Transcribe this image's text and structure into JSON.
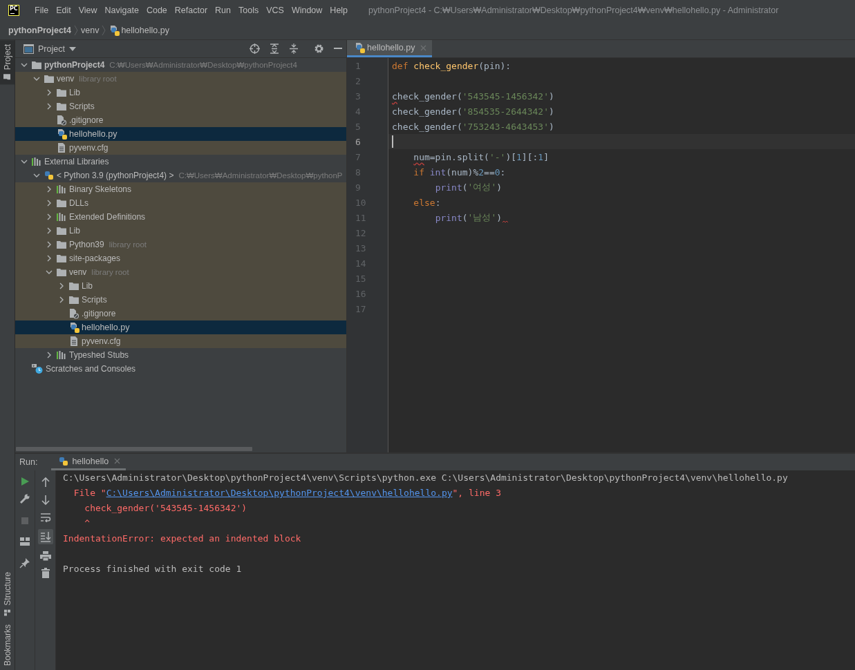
{
  "menubar": {
    "logo": "PC",
    "items": [
      "File",
      "Edit",
      "View",
      "Navigate",
      "Code",
      "Refactor",
      "Run",
      "Tools",
      "VCS",
      "Window",
      "Help"
    ],
    "title": "pythonProject4 - C:₩Users₩Administrator₩Desktop₩pythonProject4₩venv₩hellohello.py - Administrator"
  },
  "breadcrumbs": [
    {
      "label": "pythonProject4",
      "kind": "project"
    },
    {
      "label": "venv",
      "kind": "folder"
    },
    {
      "label": "hellohello.py",
      "kind": "python-file"
    }
  ],
  "tool_strip": {
    "top": [
      {
        "label": "Project",
        "kind": "project",
        "selected": true
      }
    ],
    "bottom": [
      {
        "label": "Structure",
        "kind": "structure",
        "selected": false
      },
      {
        "label": "Bookmarks",
        "kind": "bookmarks",
        "selected": false
      }
    ]
  },
  "project_panel": {
    "title": "Project",
    "tree": [
      {
        "label": "pythonProject4",
        "hint": "C:₩Users₩Administrator₩Desktop₩pythonProject4",
        "kind": "root",
        "expanded": true,
        "tinted": false,
        "selected": false,
        "children": [
          {
            "label": "venv",
            "hint": "library root",
            "kind": "folder",
            "expanded": true,
            "tinted": true,
            "selected": false,
            "children": [
              {
                "label": "Lib",
                "kind": "folder",
                "expanded": false,
                "tinted": true,
                "selected": false
              },
              {
                "label": "Scripts",
                "kind": "folder",
                "expanded": false,
                "tinted": true,
                "selected": false
              },
              {
                "label": ".gitignore",
                "kind": "ignored-file",
                "tinted": true,
                "selected": false
              },
              {
                "label": "hellohello.py",
                "kind": "python-file",
                "tinted": true,
                "selected": true
              },
              {
                "label": "pyvenv.cfg",
                "kind": "text-file",
                "tinted": true,
                "selected": false
              }
            ]
          }
        ]
      },
      {
        "label": "External Libraries",
        "kind": "library",
        "expanded": true,
        "tinted": false,
        "selected": false,
        "children": [
          {
            "label": "< Python 3.9 (pythonProject4) >",
            "hint": "C:₩Users₩Administrator₩Desktop₩pythonP",
            "kind": "python-sdk",
            "expanded": true,
            "tinted": false,
            "selected": false,
            "children": [
              {
                "label": "Binary Skeletons",
                "kind": "library",
                "expanded": false,
                "tinted": true,
                "selected": false
              },
              {
                "label": "DLLs",
                "kind": "folder",
                "expanded": false,
                "tinted": true,
                "selected": false
              },
              {
                "label": "Extended Definitions",
                "kind": "library",
                "expanded": false,
                "tinted": true,
                "selected": false
              },
              {
                "label": "Lib",
                "kind": "folder",
                "expanded": false,
                "tinted": true,
                "selected": false
              },
              {
                "label": "Python39",
                "hint": "library root",
                "kind": "folder",
                "expanded": false,
                "tinted": true,
                "selected": false
              },
              {
                "label": "site-packages",
                "kind": "folder",
                "expanded": false,
                "tinted": true,
                "selected": false
              },
              {
                "label": "venv",
                "hint": "library root",
                "kind": "folder",
                "expanded": true,
                "tinted": true,
                "selected": false,
                "children": [
                  {
                    "label": "Lib",
                    "kind": "folder",
                    "expanded": false,
                    "tinted": true,
                    "selected": false
                  },
                  {
                    "label": "Scripts",
                    "kind": "folder",
                    "expanded": false,
                    "tinted": true,
                    "selected": false
                  },
                  {
                    "label": ".gitignore",
                    "kind": "ignored-file",
                    "tinted": true,
                    "selected": false
                  },
                  {
                    "label": "hellohello.py",
                    "kind": "python-file",
                    "tinted": true,
                    "selected": true
                  },
                  {
                    "label": "pyvenv.cfg",
                    "kind": "text-file",
                    "tinted": true,
                    "selected": false
                  }
                ]
              },
              {
                "label": "Typeshed Stubs",
                "kind": "library",
                "expanded": false,
                "tinted": false,
                "selected": false
              }
            ]
          }
        ]
      },
      {
        "label": "Scratches and Consoles",
        "kind": "scratches",
        "tinted": false,
        "selected": false
      }
    ]
  },
  "editor": {
    "tabs": [
      {
        "label": "hellohello.py",
        "selected": true
      }
    ],
    "lines": [
      {
        "number": "1",
        "tokens": [
          {
            "text": "def ",
            "kind": "keyword"
          },
          {
            "text": "check_gender",
            "kind": "function"
          },
          {
            "text": "(pin):",
            "kind": "plain"
          }
        ]
      },
      {
        "number": "2"
      },
      {
        "number": "3",
        "tokens": [
          {
            "text": "c",
            "kind": "plain",
            "squiggle": true
          },
          {
            "text": "heck_gender(",
            "kind": "plain"
          },
          {
            "text": "'543545-1456342'",
            "kind": "string"
          },
          {
            "text": ")",
            "kind": "plain"
          }
        ]
      },
      {
        "number": "4",
        "tokens": [
          {
            "text": "check_gender(",
            "kind": "plain"
          },
          {
            "text": "'854535-2644342'",
            "kind": "string"
          },
          {
            "text": ")",
            "kind": "plain"
          }
        ]
      },
      {
        "number": "5",
        "tokens": [
          {
            "text": "check_gender(",
            "kind": "plain"
          },
          {
            "text": "'753243-4643453'",
            "kind": "string"
          },
          {
            "text": ")",
            "kind": "plain"
          }
        ]
      },
      {
        "number": "6",
        "current": true
      },
      {
        "number": "7",
        "tokens": [
          {
            "text": "    nu",
            "kind": "plain",
            "squiggle": true
          },
          {
            "text": "m=pin.split(",
            "kind": "plain"
          },
          {
            "text": "'-'",
            "kind": "string"
          },
          {
            "text": ")[",
            "kind": "plain"
          },
          {
            "text": "1",
            "kind": "number"
          },
          {
            "text": "][:",
            "kind": "plain"
          },
          {
            "text": "1",
            "kind": "number"
          },
          {
            "text": "]",
            "kind": "plain"
          }
        ]
      },
      {
        "number": "8",
        "tokens": [
          {
            "text": "    if ",
            "kind": "keyword"
          },
          {
            "text": "int",
            "kind": "builtin"
          },
          {
            "text": "(num)%",
            "kind": "plain"
          },
          {
            "text": "2",
            "kind": "number"
          },
          {
            "text": "==",
            "kind": "plain"
          },
          {
            "text": "0",
            "kind": "number"
          },
          {
            "text": ":",
            "kind": "plain"
          }
        ]
      },
      {
        "number": "9",
        "tokens": [
          {
            "text": "        print",
            "kind": "builtin"
          },
          {
            "text": "(",
            "kind": "plain"
          },
          {
            "text": "'여성'",
            "kind": "string"
          },
          {
            "text": ")",
            "kind": "plain"
          }
        ]
      },
      {
        "number": "10",
        "tokens": [
          {
            "text": "    else",
            "kind": "keyword"
          },
          {
            "text": ":",
            "kind": "plain"
          }
        ]
      },
      {
        "number": "11",
        "trailing_error": true,
        "tokens": [
          {
            "text": "        print",
            "kind": "builtin"
          },
          {
            "text": "(",
            "kind": "plain"
          },
          {
            "text": "'남성'",
            "kind": "string"
          },
          {
            "text": ")",
            "kind": "plain"
          }
        ]
      },
      {
        "number": "12"
      },
      {
        "number": "13"
      },
      {
        "number": "14"
      },
      {
        "number": "15"
      },
      {
        "number": "16"
      },
      {
        "number": "17"
      }
    ]
  },
  "run_panel": {
    "label": "Run:",
    "tabs": [
      {
        "label": "hellohello",
        "selected": true
      }
    ],
    "output": [
      {
        "kind": "command",
        "segments": [
          {
            "text": "C:\\Users\\Administrator\\Desktop\\pythonProject4\\venv\\Scripts\\python.exe C:\\Users\\Administrator\\Desktop\\pythonProject4\\venv\\hellohello.py",
            "kind": "text"
          }
        ]
      },
      {
        "kind": "error",
        "segments": [
          {
            "text": "  File \"",
            "kind": "text"
          },
          {
            "text": "C:\\Users\\Administrator\\Desktop\\pythonProject4\\venv\\hellohello.py",
            "kind": "link"
          },
          {
            "text": "\", line 3",
            "kind": "text"
          }
        ]
      },
      {
        "kind": "error",
        "segments": [
          {
            "text": "    check_gender('543545-1456342')",
            "kind": "text"
          }
        ]
      },
      {
        "kind": "error",
        "segments": [
          {
            "text": "    ^",
            "kind": "text"
          }
        ]
      },
      {
        "kind": "error",
        "segments": [
          {
            "text": "IndentationError: expected an indented block",
            "kind": "text"
          }
        ]
      },
      {
        "kind": "status",
        "segments": [
          {
            "text": "Process finished with exit code 1",
            "kind": "text"
          }
        ]
      }
    ]
  }
}
